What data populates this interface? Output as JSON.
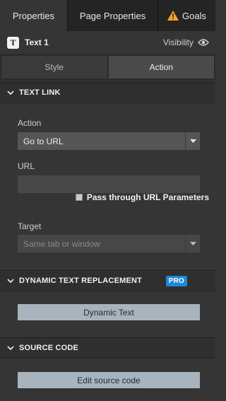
{
  "tabs": [
    {
      "label": "Properties",
      "active": true
    },
    {
      "label": "Page Properties",
      "active": false
    },
    {
      "label": "Goals",
      "active": false,
      "icon": "warning-icon",
      "icon_color": "#f5a623"
    }
  ],
  "element": {
    "icon_letter": "T",
    "name": "Text 1",
    "visibility_label": "Visibility",
    "icon": "eye-icon"
  },
  "subtabs": [
    {
      "label": "Style",
      "active": false
    },
    {
      "label": "Action",
      "active": true
    }
  ],
  "text_link": {
    "title": "TEXT LINK",
    "action_label": "Action",
    "action_value": "Go to URL",
    "url_label": "URL",
    "url_value": "",
    "pass_through_label": "Pass through URL Parameters",
    "pass_through_checked": false,
    "target_label": "Target",
    "target_placeholder": "Same tab or window"
  },
  "dynamic": {
    "title": "DYNAMIC TEXT REPLACEMENT",
    "badge": "PRO",
    "badge_color": "#1e88d6",
    "button_label": "Dynamic Text"
  },
  "source": {
    "title": "SOURCE CODE",
    "button_label": "Edit source code"
  }
}
